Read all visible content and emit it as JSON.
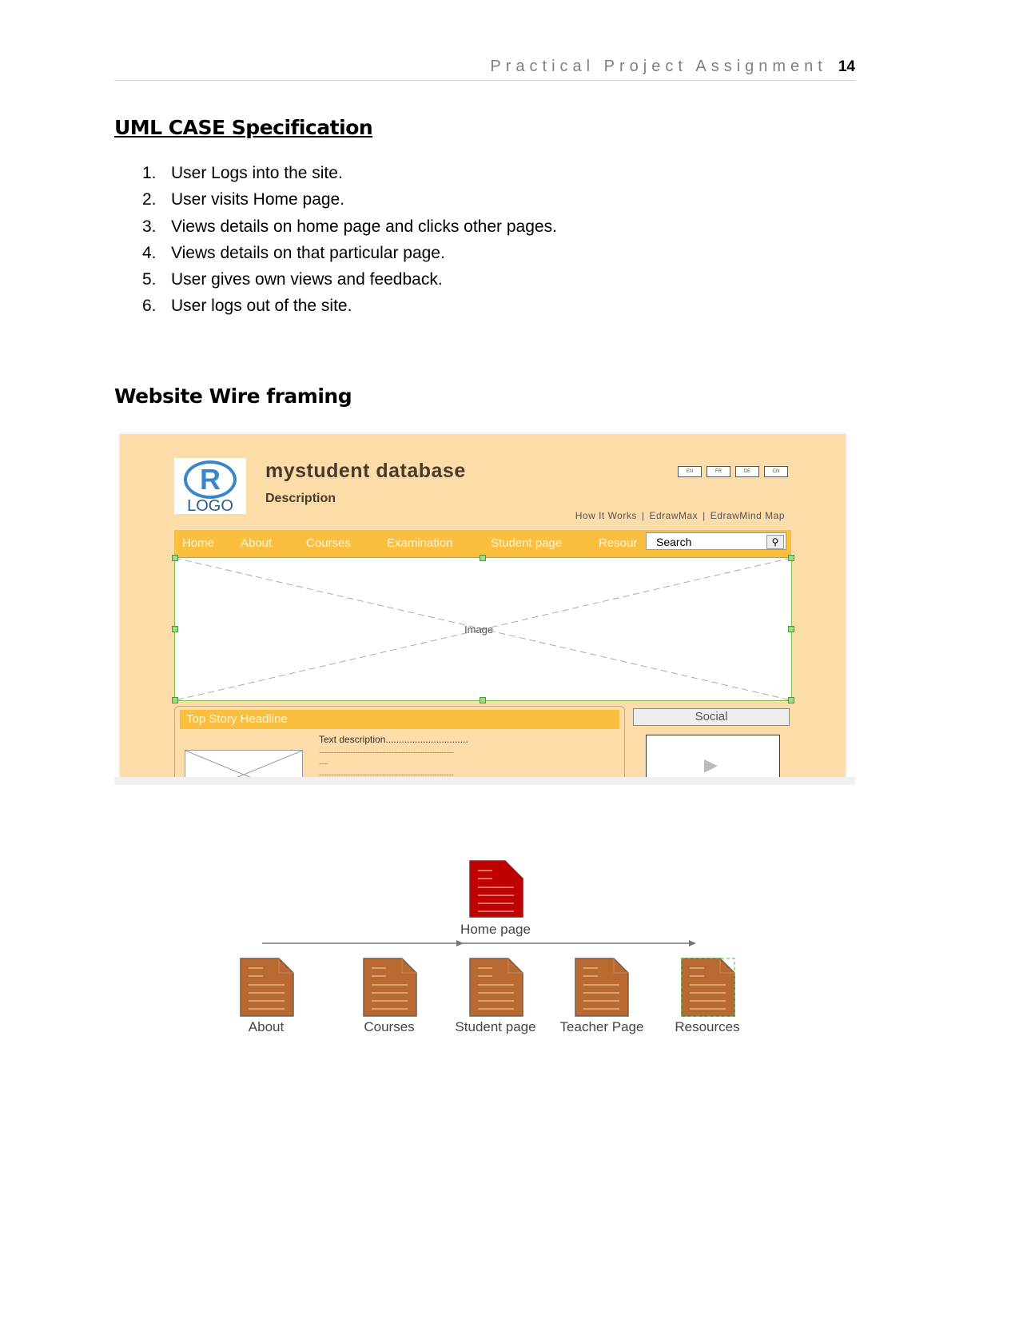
{
  "header": {
    "title": "Practical Project Assignment",
    "page_number": "14"
  },
  "section1": {
    "title": "UML CASE Specification",
    "items": [
      "User Logs into the site.",
      "User visits Home page.",
      "Views details on home page and clicks other pages.",
      "Views details on that particular page.",
      "User gives own views and feedback.",
      "User logs out of the site."
    ]
  },
  "section2": {
    "title": "Website Wire framing"
  },
  "wireframe": {
    "logo_mark": "R",
    "logo_text": "LOGO",
    "site_title": "mystudent database",
    "description": "Description",
    "languages": [
      "EN",
      "FR",
      "DE",
      "CN"
    ],
    "links": [
      "How It Works",
      "EdrawMax",
      "EdrawMind Map"
    ],
    "nav": [
      "Home",
      "About",
      "Courses",
      "Examination",
      "Student page",
      "Resour"
    ],
    "search_placeholder": "Search",
    "image_label": "Image",
    "story_headline": "Top Story Headline",
    "text_description": "Text description...............................",
    "dots1": "................................................................................................................",
    "dots2": ".......",
    "social": "Social",
    "colors": {
      "background": "#fcdca8",
      "nav": "#fbbf40"
    }
  },
  "sitemap": {
    "root": "Home page",
    "children": [
      "About",
      "Courses",
      "Student page",
      "Teacher Page",
      "Resources"
    ],
    "colors": {
      "root": "#c00000",
      "child": "#b86a30"
    }
  }
}
